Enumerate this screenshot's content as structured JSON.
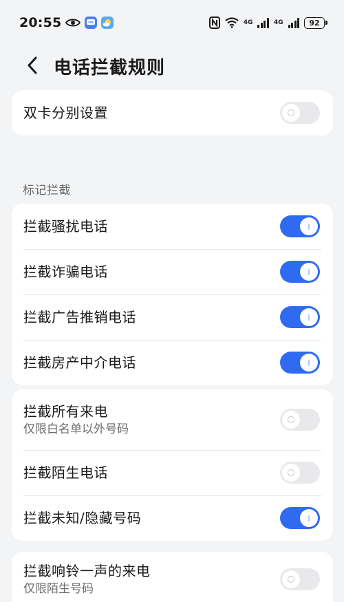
{
  "status_bar": {
    "time": "20:55",
    "net_label_1": "4G",
    "net_label_2": "4G",
    "battery": "92"
  },
  "header": {
    "title": "电话拦截规则"
  },
  "card_dual": {
    "items": [
      {
        "title": "双卡分别设置",
        "on": false
      }
    ]
  },
  "section_mark": {
    "label": "标记拦截",
    "items": [
      {
        "title": "拦截骚扰电话",
        "on": true
      },
      {
        "title": "拦截诈骗电话",
        "on": true
      },
      {
        "title": "拦截广告推销电话",
        "on": true
      },
      {
        "title": "拦截房产中介电话",
        "on": true
      }
    ]
  },
  "card_calls": {
    "items": [
      {
        "title": "拦截所有来电",
        "subtitle": "仅限白名单以外号码",
        "on": false
      },
      {
        "title": "拦截陌生电话",
        "on": false
      },
      {
        "title": "拦截未知/隐藏号码",
        "on": true
      }
    ]
  },
  "card_ring": {
    "items": [
      {
        "title": "拦截响铃一声的来电",
        "subtitle": "仅限陌生号码",
        "on": false
      }
    ]
  },
  "colors": {
    "accent": "#2f6bf0",
    "toggle_off": "#e9e9ec",
    "background": "#f3f4f6"
  }
}
